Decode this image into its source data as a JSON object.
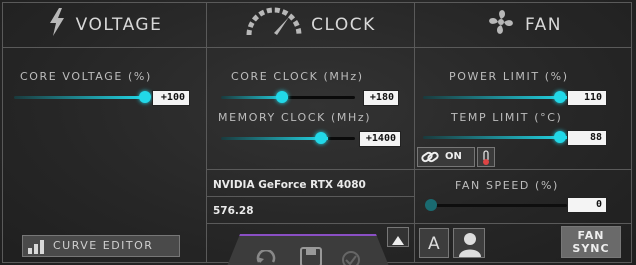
{
  "voltage": {
    "header": "VOLTAGE",
    "core_voltage": {
      "label": "CORE VOLTAGE  (%)",
      "value": "+100",
      "level": 1.0
    },
    "curve_editor_label": "CURVE EDITOR"
  },
  "clock": {
    "header": "CLOCK",
    "core_clock": {
      "label": "CORE CLOCK (MHz)",
      "value": "+180",
      "level": 0.5
    },
    "memory_clock": {
      "label": "MEMORY CLOCK (MHz)",
      "value": "+1400",
      "level": 0.7
    },
    "gpu_name": "NVIDIA GeForce RTX 4080",
    "driver_version": "576.28"
  },
  "fan": {
    "header": "FAN",
    "power_limit": {
      "label": "POWER LIMIT (%)",
      "value": "110",
      "level": 0.95
    },
    "temp_limit": {
      "label": "TEMP LIMIT (°C)",
      "value": "88",
      "level": 0.95
    },
    "link_toggle_label": "ON",
    "fan_speed": {
      "label": "FAN SPEED (%)",
      "value": "0",
      "level": 0.0
    },
    "auto_label": "A",
    "fan_sync_line1": "FAN",
    "fan_sync_line2": "SYNC"
  },
  "colors": {
    "accent": "#22d8e8",
    "background": "#2a2a2a",
    "border": "#5a5a5a"
  },
  "icons": [
    "lightning-icon",
    "speedometer-icon",
    "fan-icon",
    "bar-chart-icon",
    "link-icon",
    "thermometer-icon",
    "reset-icon",
    "save-icon",
    "apply-check-icon",
    "up-arrow-icon",
    "user-profile-icon"
  ]
}
